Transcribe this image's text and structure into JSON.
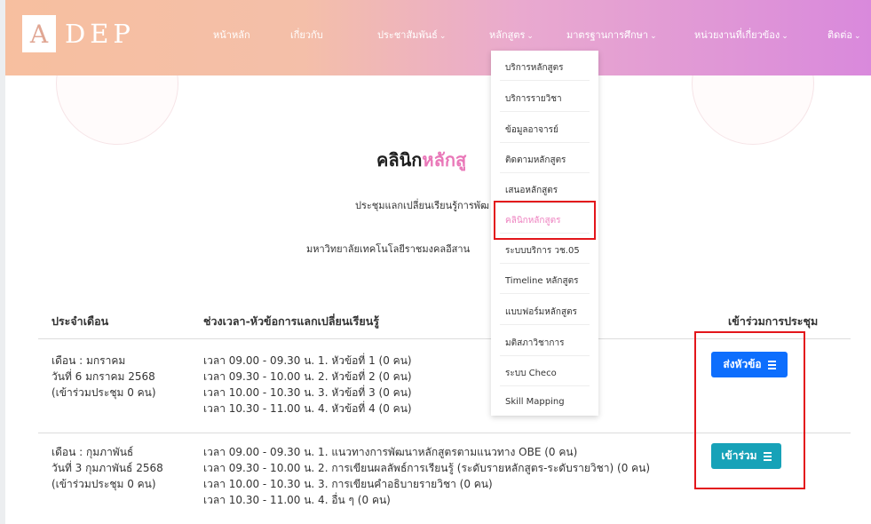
{
  "brand": {
    "logo_letter": "A",
    "logo_rest": "DEP"
  },
  "nav": {
    "items": [
      {
        "label": "หน้าหลัก",
        "caret": ""
      },
      {
        "label": "เกี่ยวกับ",
        "caret": ""
      },
      {
        "label": "ประชาสัมพันธ์",
        "caret": "⌄"
      },
      {
        "label": "หลักสูตร",
        "caret": "⌄"
      },
      {
        "label": "มาตรฐานการศึกษา",
        "caret": "⌄"
      },
      {
        "label": "หน่วยงานที่เกี่ยวข้อง",
        "caret": "⌄"
      },
      {
        "label": "ติดต่อ",
        "caret": "⌄"
      }
    ]
  },
  "dropdown": {
    "items": [
      "บริการหลักสูตร",
      "บริการรายวิชา",
      "ข้อมูลอาจารย์",
      "ติดตามหลักสูตร",
      "เสนอหลักสูตร",
      "คลินิกหลักสูตร",
      "ระบบบริการ วช.05",
      "Timeline หลักสูตร",
      "แบบฟอร์มหลักสูตร",
      "มติสภาวิชาการ",
      "ระบบ Checo",
      "Skill Mapping"
    ],
    "active_index": 5
  },
  "page": {
    "title_black": "คลินิก",
    "title_highlight": "หลักสู",
    "subtitle1": "ประชุมแลกเปลี่ยนเรียนรู้การพัฒ",
    "subtitle2": "มหาวิทยาลัยเทคโนโลยีราชมงคลอีสาน"
  },
  "table": {
    "headers": {
      "month": "ประจำเดือน",
      "topics": "ช่วงเวลา-หัวข้อการแลกเปลี่ยนเรียนรู้",
      "join": "เข้าร่วมการประชุม"
    },
    "rows": [
      {
        "month": [
          "เดือน : มกราคม",
          "วันที่ 6 มกราคม 2568",
          "(เข้าร่วมประชุม 0 คน)"
        ],
        "topics": [
          "เวลา 09.00 - 09.30 น. 1. หัวข้อที่ 1 (0 คน)",
          "เวลา 09.30 - 10.00 น. 2. หัวข้อที่ 2 (0 คน)",
          "เวลา 10.00 - 10.30 น. 3. หัวข้อที่ 3 (0 คน)",
          "เวลา 10.30 - 11.00 น. 4. หัวข้อที่ 4 (0 คน)"
        ],
        "button": "ส่งหัวข้อ"
      },
      {
        "month": [
          "เดือน : กุมภาพันธ์",
          "วันที่ 3 กุมภาพันธ์ 2568",
          "(เข้าร่วมประชุม 0 คน)"
        ],
        "topics": [
          "เวลา 09.00 - 09.30 น. 1. แนวทางการพัฒนาหลักสูตรตามแนวทาง OBE (0 คน)",
          "เวลา 09.30 - 10.00 น. 2. การเขียนผลลัพธ์การเรียนรู้ (ระดับรายหลักสูตร-ระดับรายวิชา) (0 คน)",
          "เวลา 10.00 - 10.30 น. 3. การเขียนคำอธิบายรายวิชา (0 คน)",
          "เวลา 10.30 - 11.00 น. 4. อื่น ๆ (0 คน)"
        ],
        "button": "เข้าร่วม"
      }
    ]
  },
  "colors": {
    "accent_pink": "#e977b8",
    "button_blue": "#0d6efd",
    "button_teal": "#17a2b8",
    "highlight_box": "#e3161b"
  }
}
